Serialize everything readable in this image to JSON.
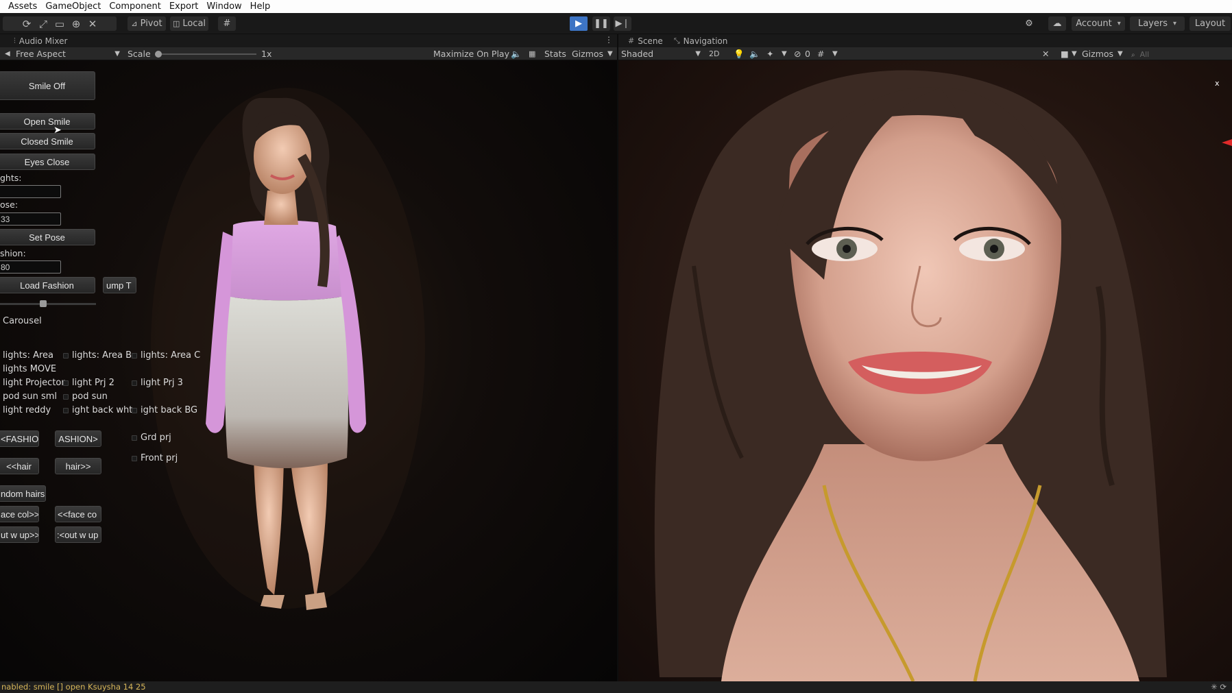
{
  "menu": [
    "Assets",
    "GameObject",
    "Component",
    "Export",
    "Window",
    "Help"
  ],
  "toolbar": {
    "pivot_label": "Pivot",
    "local_label": "Local",
    "account_label": "Account",
    "layers_label": "Layers",
    "layout_label": "Layout"
  },
  "game_panel": {
    "tab_label": "Audio Mixer",
    "aspect_label": "Free Aspect",
    "scale_label": "Scale",
    "scale_value": "1x",
    "maximize_label": "Maximize On Play",
    "stats_label": "Stats",
    "gizmos_label": "Gizmos"
  },
  "scene_panel": {
    "scene_tab": "Scene",
    "navigation_tab": "Navigation",
    "shading_label": "Shaded",
    "mode_2d_label": "2D",
    "hidden_count": "0",
    "gizmos_label": "Gizmos",
    "search_placeholder": "All",
    "axis_label": "x"
  },
  "game_ui": {
    "smile_off": "Smile Off",
    "open_smile": "Open Smile",
    "closed_smile": "Closed Smile",
    "eyes_close": "Eyes Close",
    "lights_label": "ghts:",
    "lights_value": "",
    "pose_label": "ose:",
    "pose_value": "33",
    "set_pose": "Set Pose",
    "fashion_label": "shion:",
    "fashion_value": "80",
    "load_fashion": "Load Fashion",
    "jump_to": "ump T",
    "carousel": "Carousel",
    "checkboxes": {
      "lights_area": "lights: Area",
      "lights_area_b": "lights: Area B",
      "lights_area_c": "lights: Area C",
      "lights_move": "lights MOVE",
      "light_projector": "light Projector",
      "light_prj2": "light Prj 2",
      "light_prj3": "light Prj 3",
      "pod_sun_sml": "pod sun sml",
      "pod_sun": "pod sun",
      "light_reddy": "light reddy",
      "light_back_wht": "ight back wht",
      "light_back_bg": "ight back BG",
      "grd_prj": "Grd prj",
      "front_prj": "Front prj"
    },
    "prev_fashion": "<FASHIO",
    "next_fashion": "ASHION>",
    "prev_hair": "<<hair",
    "next_hair": "hair>>",
    "random_hairs": "ndom hairs",
    "next_face_col": "ace col>>",
    "prev_face_col": "<<face co",
    "next_out_w_up": "ut w up>>",
    "prev_out_w_up": ":<out w up"
  },
  "status": {
    "message": "nabled: smile [] open Ksuysha 14 25"
  }
}
